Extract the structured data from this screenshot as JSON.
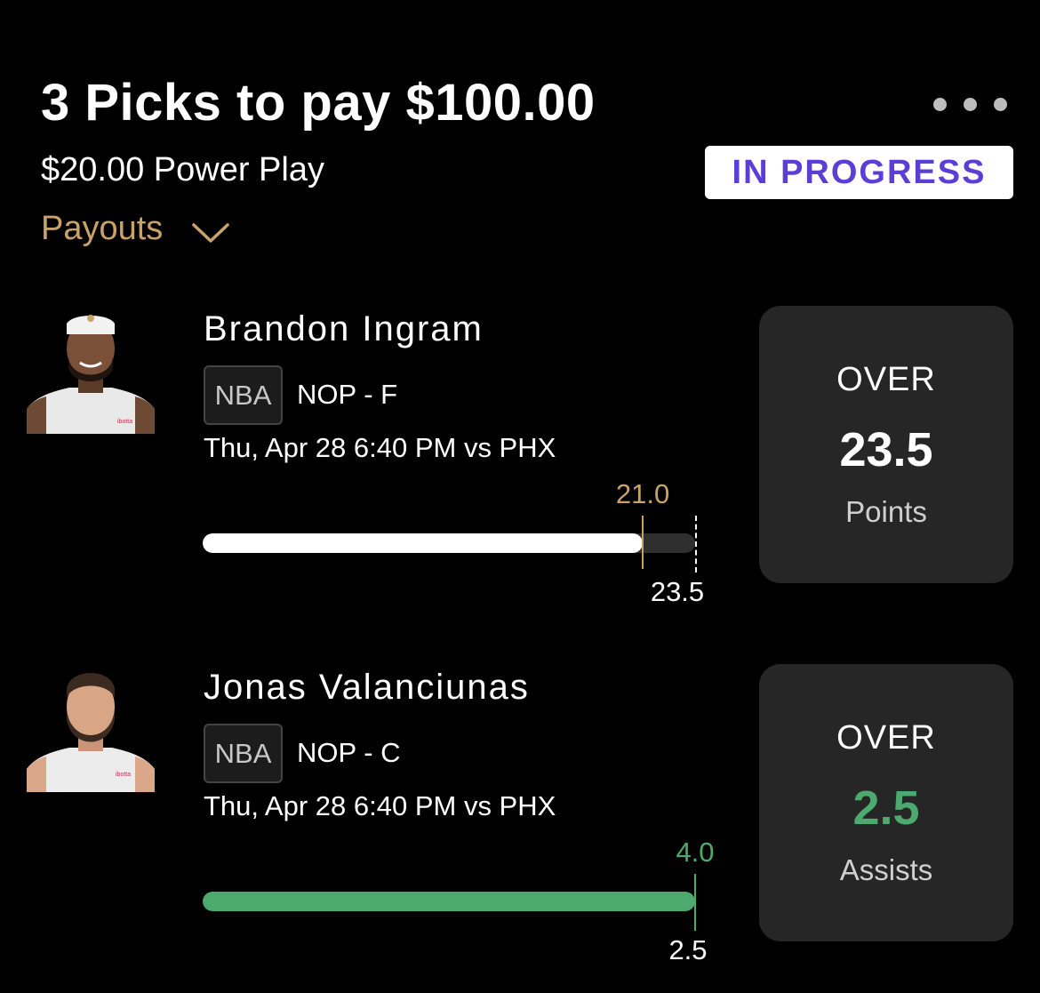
{
  "header": {
    "title": "3 Picks to pay $100.00",
    "subtitle": "$20.00 Power Play",
    "status": "IN PROGRESS",
    "payouts_label": "Payouts"
  },
  "colors": {
    "accent_gold": "#c9a268",
    "status_text": "#5a3fd6",
    "hit_green": "#4caa6e"
  },
  "picks": [
    {
      "player": "Brandon Ingram",
      "league": "NBA",
      "team_pos": "NOP - F",
      "game": "Thu, Apr 28 6:40 PM  vs PHX",
      "current": "21.0",
      "current_value": 21.0,
      "line": "23.5",
      "line_value": 23.5,
      "direction": "OVER",
      "stat": "Points",
      "hit": false
    },
    {
      "player": "Jonas Valanciunas",
      "league": "NBA",
      "team_pos": "NOP - C",
      "game": "Thu, Apr 28 6:40 PM  vs PHX",
      "current": "4.0",
      "current_value": 4.0,
      "line": "2.5",
      "line_value": 2.5,
      "direction": "OVER",
      "stat": "Assists",
      "hit": true
    }
  ]
}
